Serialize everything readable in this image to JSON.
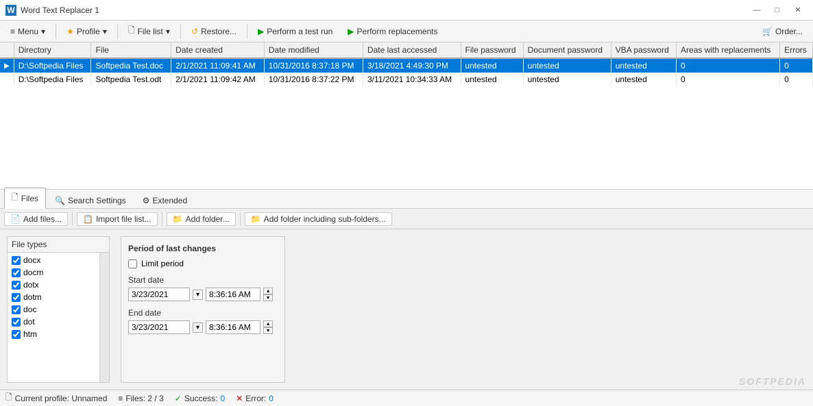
{
  "titlebar": {
    "icon": "W",
    "title": "Word Text Replacer 1",
    "minimize": "—",
    "maximize": "□",
    "close": "✕"
  },
  "toolbar": {
    "menu_label": "Menu",
    "profile_label": "Profile",
    "filelist_label": "File list",
    "restore_label": "Restore...",
    "test_run_label": "Perform a test run",
    "replacements_label": "Perform replacements",
    "order_label": "Order..."
  },
  "table": {
    "columns": [
      "",
      "Directory",
      "File",
      "Date created",
      "Date modified",
      "Date last accessed",
      "File password",
      "Document password",
      "VBA password",
      "Areas with replacements",
      "Errors"
    ],
    "rows": [
      {
        "selected": true,
        "arrow": "▶",
        "directory": "D:\\Softpedia Files",
        "file": "Softpedia Test.doc",
        "date_created": "2/1/2021 11:09:41 AM",
        "date_modified": "10/31/2016 8:37:18 PM",
        "date_accessed": "3/18/2021 4:49:30 PM",
        "file_password": "untested",
        "doc_password": "untested",
        "vba_password": "untested",
        "areas": "0",
        "errors": "0"
      },
      {
        "selected": false,
        "arrow": "",
        "directory": "D:\\Softpedia Files",
        "file": "Softpedia Test.odt",
        "date_created": "2/1/2021 11:09:42 AM",
        "date_modified": "10/31/2016 8:37:22 PM",
        "date_accessed": "3/11/2021 10:34:33 AM",
        "file_password": "untested",
        "doc_password": "untested",
        "vba_password": "untested",
        "areas": "0",
        "errors": "0"
      }
    ]
  },
  "tabs": [
    {
      "id": "files",
      "label": "Files",
      "icon": "🗋",
      "active": true
    },
    {
      "id": "search",
      "label": "Search Settings",
      "icon": "🔍",
      "active": false
    },
    {
      "id": "extended",
      "label": "Extended",
      "icon": "⚙",
      "active": false
    }
  ],
  "action_toolbar": {
    "add_files": "Add files...",
    "import_list": "Import file list...",
    "add_folder": "Add folder...",
    "add_folder_sub": "Add folder including sub-folders..."
  },
  "file_types": {
    "title": "File types",
    "items": [
      {
        "checked": true,
        "label": "docx"
      },
      {
        "checked": true,
        "label": "docm"
      },
      {
        "checked": true,
        "label": "dotx"
      },
      {
        "checked": true,
        "label": "dotm"
      },
      {
        "checked": true,
        "label": "doc"
      },
      {
        "checked": true,
        "label": "dot"
      },
      {
        "checked": true,
        "label": "htm"
      }
    ]
  },
  "period": {
    "title": "Period of last changes",
    "limit_label": "Limit period",
    "start_label": "Start date",
    "start_date": "3/23/2021",
    "start_time": "8:36:16 AM",
    "end_label": "End date",
    "end_date": "3/23/2021",
    "end_time": "8:36:16 AM"
  },
  "statusbar": {
    "profile_label": "Current profile: Unnamed",
    "files_label": "Files: 2 / 3",
    "success_label": "Success:",
    "success_count": "0",
    "error_label": "Error:",
    "error_count": "0",
    "watermark": "SOFTPEDIA"
  }
}
